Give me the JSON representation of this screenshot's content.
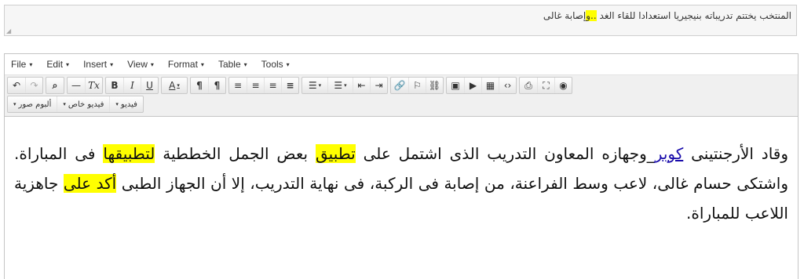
{
  "summary": {
    "text_before": "المنتخب يختتم تدريباته بنيجيريا استعدادا للقاء الغد ",
    "text_highlight": "..و",
    "text_after": "إصابة غالى"
  },
  "menubar": {
    "items": [
      {
        "label": "File"
      },
      {
        "label": "Edit"
      },
      {
        "label": "Insert"
      },
      {
        "label": "View"
      },
      {
        "label": "Format"
      },
      {
        "label": "Table"
      },
      {
        "label": "Tools"
      }
    ],
    "caret": "▾"
  },
  "toolbar": {
    "undo": "↶",
    "redo": "↷",
    "find": "⌕",
    "hr": "—",
    "clear_format": "Tx",
    "bold": "B",
    "italic": "I",
    "underline": "U",
    "font_color": "A",
    "ltr": "¶",
    "rtl": "¶",
    "align_left": "≡",
    "align_center": "≡",
    "align_right": "≡",
    "align_justify": "≡",
    "bullet_list": "☰",
    "numbered_list": "☰",
    "outdent": "⇤",
    "indent": "⇥",
    "link": "🔗",
    "anchor": "⚐",
    "unlink": "⛓",
    "image": "▣",
    "media": "▶",
    "table": "▦",
    "code": "‹›",
    "print": "⎙",
    "fullscreen": "⛶",
    "preview": "◉",
    "custom_buttons": [
      "ألبوم صور",
      "فيديو خاص",
      "فيديو"
    ]
  },
  "content": {
    "seg1": "وقاد الأرجنتينى ",
    "link": "كوبر",
    "seg2": "_وجهازه المعاون التدريب الذى اشتمل على ",
    "hl1": "تطبيق",
    "seg3": " بعض الجمل الخططية ",
    "hl2": "لتطبيقها",
    "seg4": " فى المباراة. واشتكى حسام غالى، لاعب وسط الفراعنة، من إصابة فى الركبة، فى نهاية التدريب، إلا أن الجهاز الطبى ",
    "hl3": "أكد على",
    "seg5": " جاهزية اللاعب للمباراة."
  }
}
